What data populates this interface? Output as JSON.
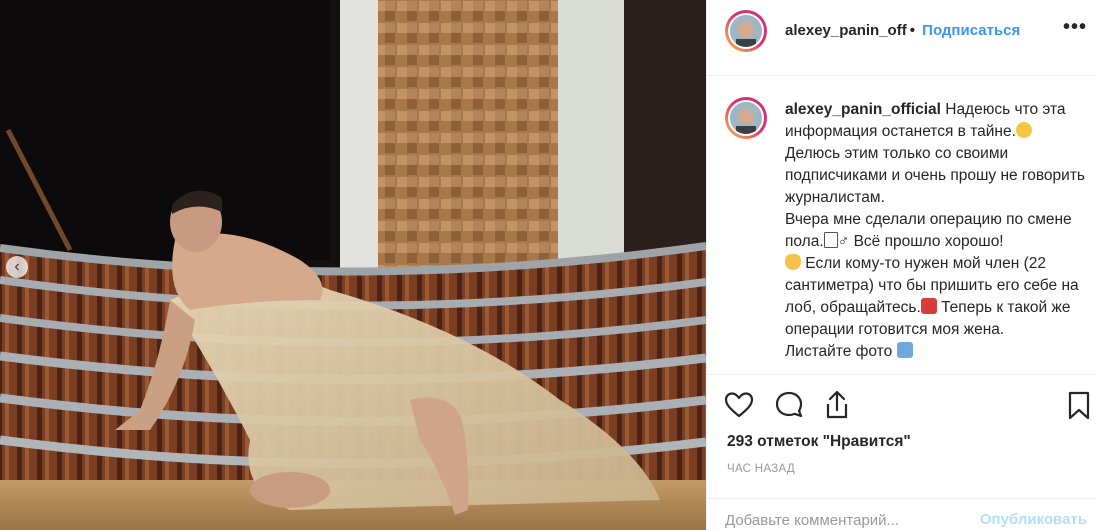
{
  "post": {
    "username": "alexey_panin_off",
    "separator": "•",
    "follow_label": "Подписаться",
    "more_label": "•••"
  },
  "caption": {
    "username": "alexey_panin_official",
    "text_1": " Надеюсь что эта информация останется в тайне.",
    "text_2": "\nДелюсь этим только со своими подписчиками и очень прошу не говорить журналистам.\nВчера мне сделали операцию по смене пола.",
    "text_3": "♂ Всё прошло хорошо!\n",
    "text_4": " Если кому-то нужен мой член (22 сантиметра) что бы пришить его себе на лоб, обращайтесь.",
    "text_5": " Теперь к такой же операции готовится моя жена.\nЛистайте фото "
  },
  "actions": {
    "likes_text": "293 отметок \"Нравится\"",
    "time_text": "ЧАС НАЗАД"
  },
  "comment_box": {
    "placeholder": "Добавьте комментарий...",
    "publish_label": "Опубликовать"
  },
  "icons": {
    "like": "heart-icon",
    "comment": "comment-icon",
    "share": "share-icon",
    "save": "bookmark-icon",
    "carousel_prev": "chevron-left-icon",
    "more": "more-options-icon"
  },
  "colors": {
    "link": "#3897f0",
    "publish_disabled": "#b2dffc",
    "text": "#262626",
    "muted": "#999999",
    "border": "#efefef"
  }
}
